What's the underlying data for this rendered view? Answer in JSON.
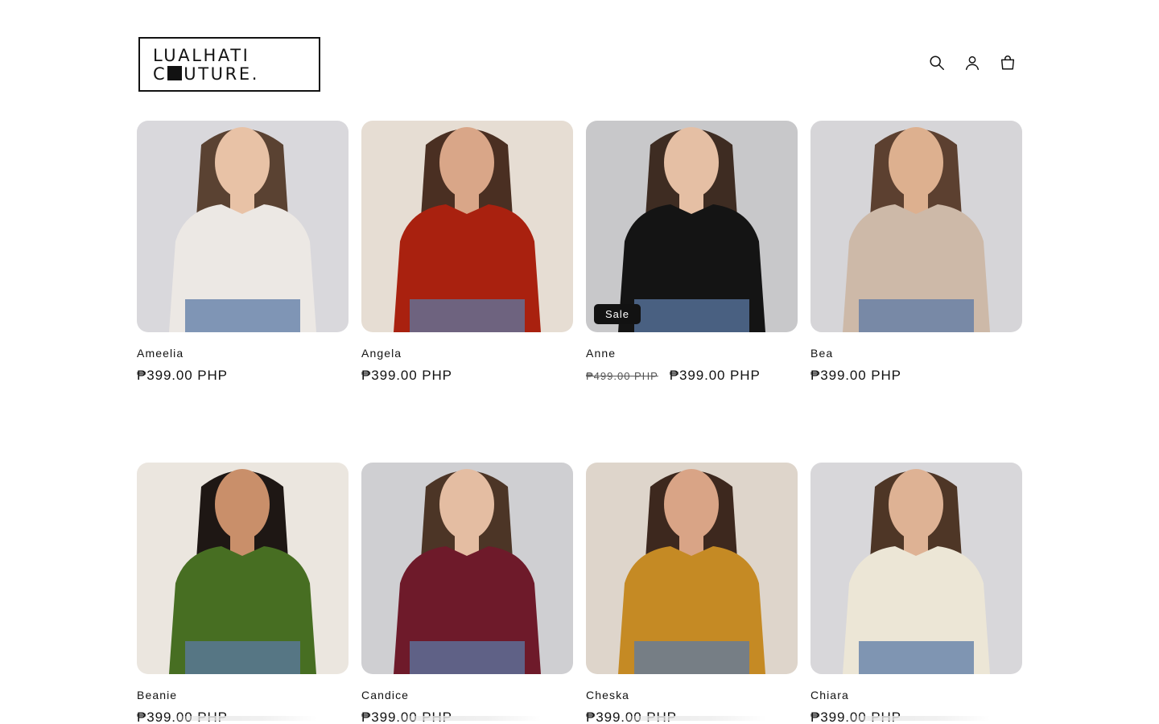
{
  "header": {
    "logo_line1": "LUALHATI",
    "logo_line2_pre": "C",
    "logo_line2_post": "UTURE.",
    "icons": [
      "search-icon",
      "account-icon",
      "cart-icon"
    ]
  },
  "products": [
    {
      "name": "Ameelia",
      "price": "₱399.00 PHP",
      "compare_price": "",
      "badge": "",
      "colors": {
        "bg": "#d9d8dc",
        "top": "#ece8e4",
        "skin": "#e8c2a6",
        "hair": "#5a4232"
      }
    },
    {
      "name": "Angela",
      "price": "₱399.00 PHP",
      "compare_price": "",
      "badge": "",
      "colors": {
        "bg": "#e6ddd3",
        "top": "#a9210f",
        "skin": "#d9a688",
        "hair": "#4a2f22"
      }
    },
    {
      "name": "Anne",
      "price": "₱399.00 PHP",
      "compare_price": "₱499.00 PHP",
      "badge": "Sale",
      "colors": {
        "bg": "#c8c8ca",
        "top": "#141414",
        "skin": "#e5bfa4",
        "hair": "#3e2c22"
      }
    },
    {
      "name": "Bea",
      "price": "₱399.00 PHP",
      "compare_price": "",
      "badge": "",
      "colors": {
        "bg": "#d6d5d8",
        "top": "#cdb9a8",
        "skin": "#ddb08f",
        "hair": "#5c4030"
      }
    },
    {
      "name": "Beanie",
      "price": "₱399.00 PHP",
      "compare_price": "",
      "badge": "",
      "colors": {
        "bg": "#ebe6df",
        "top": "#476e22",
        "skin": "#c98f6a",
        "hair": "#1e1714"
      }
    },
    {
      "name": "Candice",
      "price": "₱399.00 PHP",
      "compare_price": "",
      "badge": "",
      "colors": {
        "bg": "#cfcfd2",
        "top": "#6e1a2a",
        "skin": "#e4bda2",
        "hair": "#4c3526"
      }
    },
    {
      "name": "Cheska",
      "price": "₱399.00 PHP",
      "compare_price": "",
      "badge": "",
      "colors": {
        "bg": "#ded5cb",
        "top": "#c58a24",
        "skin": "#d9a486",
        "hair": "#3d281e"
      }
    },
    {
      "name": "Chiara",
      "price": "₱399.00 PHP",
      "compare_price": "",
      "badge": "",
      "colors": {
        "bg": "#d8d7da",
        "top": "#ece6d6",
        "skin": "#deb294",
        "hair": "#4e3626"
      }
    }
  ]
}
